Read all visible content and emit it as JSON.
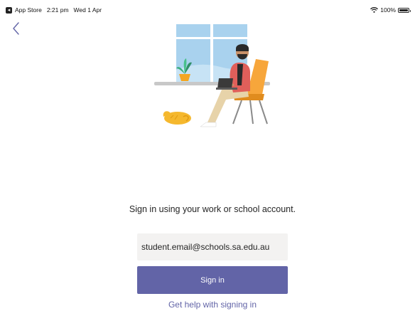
{
  "status_bar": {
    "back_app": "App Store",
    "time": "2:21 pm",
    "date": "Wed 1 Apr",
    "battery": "100%",
    "icons": [
      "wifi-icon",
      "battery-icon"
    ]
  },
  "nav": {
    "back_icon": "chevron-left-icon"
  },
  "signin": {
    "prompt": "Sign in using your work or school account.",
    "email_value": "student.email@schools.sa.edu.au",
    "button_label": "Sign in",
    "help_link": "Get help with signing in"
  },
  "colors": {
    "accent": "#6264a7",
    "input_bg": "#f3f2f1",
    "text": "#252525"
  }
}
